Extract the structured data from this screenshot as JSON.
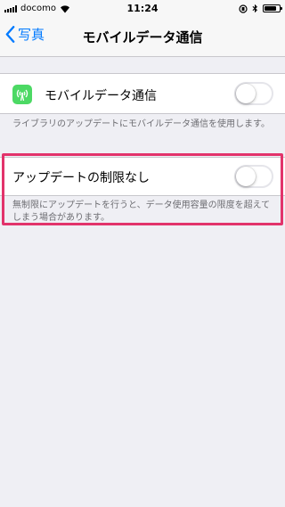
{
  "status_bar": {
    "carrier": "docomo",
    "time": "11:24",
    "battery_level": 0.8
  },
  "nav": {
    "back_label": "写真",
    "title": "モバイルデータ通信"
  },
  "cellular_row": {
    "icon": "cellular-antenna-icon",
    "label": "モバイルデータ通信",
    "toggle_on": false,
    "footer": "ライブラリのアップデートにモバイルデータ通信を使用します。"
  },
  "unlimited_row": {
    "label": "アップデートの制限なし",
    "toggle_on": false,
    "footer": "無制限にアップデートを行うと、データ使用容量の限度を超えてしまう場合があります。"
  },
  "colors": {
    "accent": "#007aff",
    "background": "#efeff4",
    "highlight": "#e2336b",
    "icon_green": "#4cd964"
  }
}
